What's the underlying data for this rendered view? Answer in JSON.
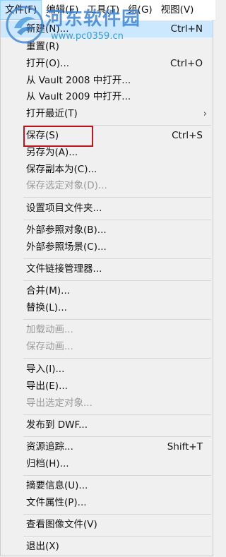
{
  "menubar": {
    "items": [
      "文件(F)",
      "编辑(E)",
      "工具(T)",
      "组(G)",
      "视图(V)"
    ]
  },
  "watermark": {
    "name": "河东软件园",
    "url": "www.pc0359.cn"
  },
  "menu": {
    "items": [
      {
        "label": "新建(N)...",
        "shortcut": "Ctrl+N"
      },
      {
        "label": "重置(R)",
        "shortcut": ""
      },
      {
        "label": "打开(O)...",
        "shortcut": "Ctrl+O"
      },
      {
        "label": "从 Vault 2008 中打开...",
        "shortcut": ""
      },
      {
        "label": "从 Vault 2009 中打开...",
        "shortcut": ""
      },
      {
        "label": "打开最近(T)",
        "shortcut": "",
        "arrow": "›"
      },
      {
        "label": "保存(S)",
        "shortcut": "Ctrl+S"
      },
      {
        "label": "另存为(A)...",
        "shortcut": ""
      },
      {
        "label": "保存副本为(C)...",
        "shortcut": ""
      },
      {
        "label": "保存选定对象(D)...",
        "shortcut": "",
        "disabled": true
      },
      {
        "label": "设置项目文件夹...",
        "shortcut": ""
      },
      {
        "label": "外部参照对象(B)...",
        "shortcut": ""
      },
      {
        "label": "外部参照场景(C)...",
        "shortcut": ""
      },
      {
        "label": "文件链接管理器...",
        "shortcut": ""
      },
      {
        "label": "合并(M)...",
        "shortcut": ""
      },
      {
        "label": "替换(L)...",
        "shortcut": ""
      },
      {
        "label": "加载动画...",
        "shortcut": "",
        "disabled": true
      },
      {
        "label": "保存动画...",
        "shortcut": "",
        "disabled": true
      },
      {
        "label": "导入(I)...",
        "shortcut": ""
      },
      {
        "label": "导出(E)...",
        "shortcut": ""
      },
      {
        "label": "导出选定对象...",
        "shortcut": "",
        "disabled": true
      },
      {
        "label": "发布到 DWF...",
        "shortcut": ""
      },
      {
        "label": "资源追踪...",
        "shortcut": "Shift+T"
      },
      {
        "label": "归档(H)...",
        "shortcut": ""
      },
      {
        "label": "摘要信息(U)...",
        "shortcut": ""
      },
      {
        "label": "文件属性(P)...",
        "shortcut": ""
      },
      {
        "label": "查看图像文件(V)",
        "shortcut": ""
      },
      {
        "label": "退出(X)",
        "shortcut": ""
      }
    ]
  }
}
